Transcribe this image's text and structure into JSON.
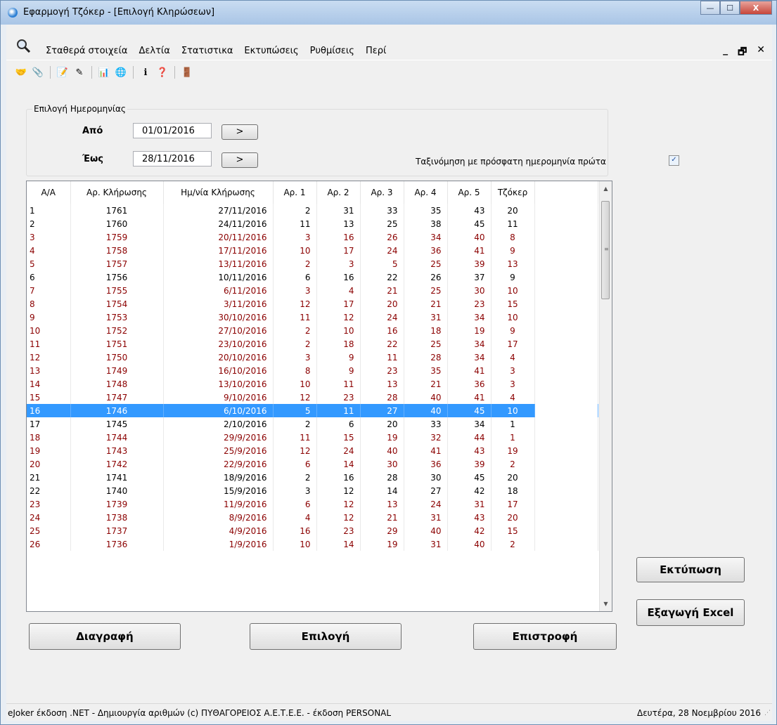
{
  "window": {
    "title": "Εφαρμογή Τζόκερ - [Επιλογή Κληρώσεων]",
    "controls": {
      "minimize": "—",
      "maximize": "☐",
      "close": "X"
    }
  },
  "menu": {
    "items": [
      "Σταθερά στοιχεία",
      "Δελτία",
      "Στατιστικα",
      "Εκτυπώσεις",
      "Ρυθμίσεις",
      "Περί"
    ],
    "mdi_controls": {
      "minimize": "_",
      "restore": "🗗",
      "close": "✕"
    }
  },
  "toolbar": {
    "icons": [
      "handshake-icon",
      "pin-icon",
      "report-icon",
      "tools-icon",
      "chart-icon",
      "globe-icon",
      "info-icon",
      "help-icon",
      "exit-icon"
    ]
  },
  "date_filter": {
    "group_title": "Επιλογή Ημερομηνίας",
    "from_label": "Από",
    "from_value": "01/01/2016",
    "to_label": "Έως",
    "to_value": "28/11/2016",
    "go_label": ">",
    "sort_label": "Ταξινόμηση με πρόσφατη ημερομηνία πρώτα",
    "sort_checked": "✓"
  },
  "grid": {
    "columns": [
      "A/A",
      "Αρ. Κλήρωσης",
      "Ημ/νία Κλήρωσης",
      "Αρ. 1",
      "Αρ. 2",
      "Αρ. 3",
      "Αρ. 4",
      "Αρ. 5",
      "Τζόκερ"
    ],
    "rows": [
      [
        "1",
        "1761",
        "27/11/2016",
        "2",
        "31",
        "33",
        "35",
        "43",
        "20"
      ],
      [
        "2",
        "1760",
        "24/11/2016",
        "11",
        "13",
        "25",
        "38",
        "45",
        "11"
      ],
      [
        "3",
        "1759",
        "20/11/2016",
        "3",
        "16",
        "26",
        "34",
        "40",
        "8"
      ],
      [
        "4",
        "1758",
        "17/11/2016",
        "10",
        "17",
        "24",
        "36",
        "41",
        "9"
      ],
      [
        "5",
        "1757",
        "13/11/2016",
        "2",
        "3",
        "5",
        "25",
        "39",
        "13"
      ],
      [
        "6",
        "1756",
        "10/11/2016",
        "6",
        "16",
        "22",
        "26",
        "37",
        "9"
      ],
      [
        "7",
        "1755",
        "6/11/2016",
        "3",
        "4",
        "21",
        "25",
        "30",
        "10"
      ],
      [
        "8",
        "1754",
        "3/11/2016",
        "12",
        "17",
        "20",
        "21",
        "23",
        "15"
      ],
      [
        "9",
        "1753",
        "30/10/2016",
        "11",
        "12",
        "24",
        "31",
        "34",
        "10"
      ],
      [
        "10",
        "1752",
        "27/10/2016",
        "2",
        "10",
        "16",
        "18",
        "19",
        "9"
      ],
      [
        "11",
        "1751",
        "23/10/2016",
        "2",
        "18",
        "22",
        "25",
        "34",
        "17"
      ],
      [
        "12",
        "1750",
        "20/10/2016",
        "3",
        "9",
        "11",
        "28",
        "34",
        "4"
      ],
      [
        "13",
        "1749",
        "16/10/2016",
        "8",
        "9",
        "23",
        "35",
        "41",
        "3"
      ],
      [
        "14",
        "1748",
        "13/10/2016",
        "10",
        "11",
        "13",
        "21",
        "36",
        "3"
      ],
      [
        "15",
        "1747",
        "9/10/2016",
        "12",
        "23",
        "28",
        "40",
        "41",
        "4"
      ],
      [
        "16",
        "1746",
        "6/10/2016",
        "5",
        "11",
        "27",
        "40",
        "45",
        "10"
      ],
      [
        "17",
        "1745",
        "2/10/2016",
        "2",
        "6",
        "20",
        "33",
        "34",
        "1"
      ],
      [
        "18",
        "1744",
        "29/9/2016",
        "11",
        "15",
        "19",
        "32",
        "44",
        "1"
      ],
      [
        "19",
        "1743",
        "25/9/2016",
        "12",
        "24",
        "40",
        "41",
        "43",
        "19"
      ],
      [
        "20",
        "1742",
        "22/9/2016",
        "6",
        "14",
        "30",
        "36",
        "39",
        "2"
      ],
      [
        "21",
        "1741",
        "18/9/2016",
        "2",
        "16",
        "28",
        "30",
        "45",
        "20"
      ],
      [
        "22",
        "1740",
        "15/9/2016",
        "3",
        "12",
        "14",
        "27",
        "42",
        "18"
      ],
      [
        "23",
        "1739",
        "11/9/2016",
        "6",
        "12",
        "13",
        "24",
        "31",
        "17"
      ],
      [
        "24",
        "1738",
        "8/9/2016",
        "4",
        "12",
        "21",
        "31",
        "43",
        "20"
      ],
      [
        "25",
        "1737",
        "4/9/2016",
        "16",
        "23",
        "29",
        "40",
        "42",
        "15"
      ],
      [
        "26",
        "1736",
        "1/9/2016",
        "10",
        "14",
        "19",
        "31",
        "40",
        "2"
      ]
    ],
    "row_colors": [
      "black",
      "black",
      "red",
      "red",
      "red",
      "black",
      "red",
      "red",
      "red",
      "red",
      "red",
      "red",
      "red",
      "red",
      "red",
      "sel",
      "black",
      "red",
      "red",
      "red",
      "black",
      "black",
      "red",
      "red",
      "red",
      "red"
    ],
    "selected_row": "16"
  },
  "buttons": {
    "print": "Εκτύπωση",
    "excel": "Εξαγωγή Excel",
    "delete": "Διαγραφή",
    "select": "Επιλογή",
    "return": "Επιστροφή"
  },
  "status": {
    "left": "eJoker έκδοση .NET  - Δημιουργία αριθμών  (c) ΠΥΘΑΓΟΡΕΙΟΣ  Α.Ε.Τ.Ε.Ε.  - έκδοση PERSONAL",
    "right": "Δευτέρα, 28 Νοεμβρίου 2016"
  },
  "colors": {
    "selection": "#3399ff",
    "dark_red_text": "#8b0000"
  }
}
